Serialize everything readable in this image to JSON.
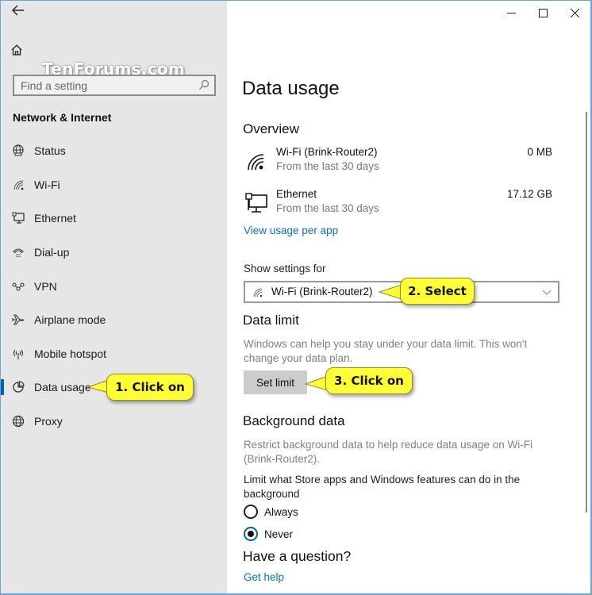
{
  "window": {
    "back_label": "Back",
    "controls": {
      "minimize": "minimize",
      "maximize": "maximize",
      "close": "close"
    }
  },
  "sidebar": {
    "home_label": "Home",
    "watermark": "TenForums.com",
    "search_placeholder": "Find a setting",
    "section_title": "Network & Internet",
    "items": [
      {
        "label": "Status",
        "icon": "status-globe-icon",
        "active": false
      },
      {
        "label": "Wi-Fi",
        "icon": "wifi-icon",
        "active": false
      },
      {
        "label": "Ethernet",
        "icon": "ethernet-icon",
        "active": false
      },
      {
        "label": "Dial-up",
        "icon": "dialup-icon",
        "active": false
      },
      {
        "label": "VPN",
        "icon": "vpn-icon",
        "active": false
      },
      {
        "label": "Airplane mode",
        "icon": "airplane-icon",
        "active": false
      },
      {
        "label": "Mobile hotspot",
        "icon": "hotspot-icon",
        "active": false
      },
      {
        "label": "Data usage",
        "icon": "pie-chart-icon",
        "active": true
      },
      {
        "label": "Proxy",
        "icon": "globe-icon",
        "active": false
      }
    ]
  },
  "main": {
    "title": "Data usage",
    "overview": {
      "heading": "Overview",
      "rows": [
        {
          "name": "Wi-Fi (Brink-Router2)",
          "sub": "From the last 30 days",
          "value": "0 MB",
          "icon": "wifi-icon"
        },
        {
          "name": "Ethernet",
          "sub": "From the last 30 days",
          "value": "17.12 GB",
          "icon": "ethernet-icon"
        }
      ],
      "link": "View usage per app"
    },
    "show_settings": {
      "label": "Show settings for",
      "selected": "Wi-Fi (Brink-Router2)"
    },
    "data_limit": {
      "heading": "Data limit",
      "description": "Windows can help you stay under your data limit. This won't change your data plan.",
      "button": "Set limit"
    },
    "background_data": {
      "heading": "Background data",
      "description": "Restrict background data to help reduce data usage on Wi-Fi (Brink-Router2).",
      "question": "Limit what Store apps and Windows features can do in the background",
      "options": [
        {
          "label": "Always",
          "checked": false
        },
        {
          "label": "Never",
          "checked": true
        }
      ]
    },
    "help": {
      "heading": "Have a question?",
      "link": "Get help"
    }
  },
  "callouts": [
    {
      "text": "1. Click on"
    },
    {
      "text": "2. Select"
    },
    {
      "text": "3. Click on"
    }
  ],
  "colors": {
    "accent": "#0063b1",
    "link": "#0a6fc2",
    "sidebar_bg": "#e6e6e6",
    "callout_bg": "#ffff33"
  }
}
